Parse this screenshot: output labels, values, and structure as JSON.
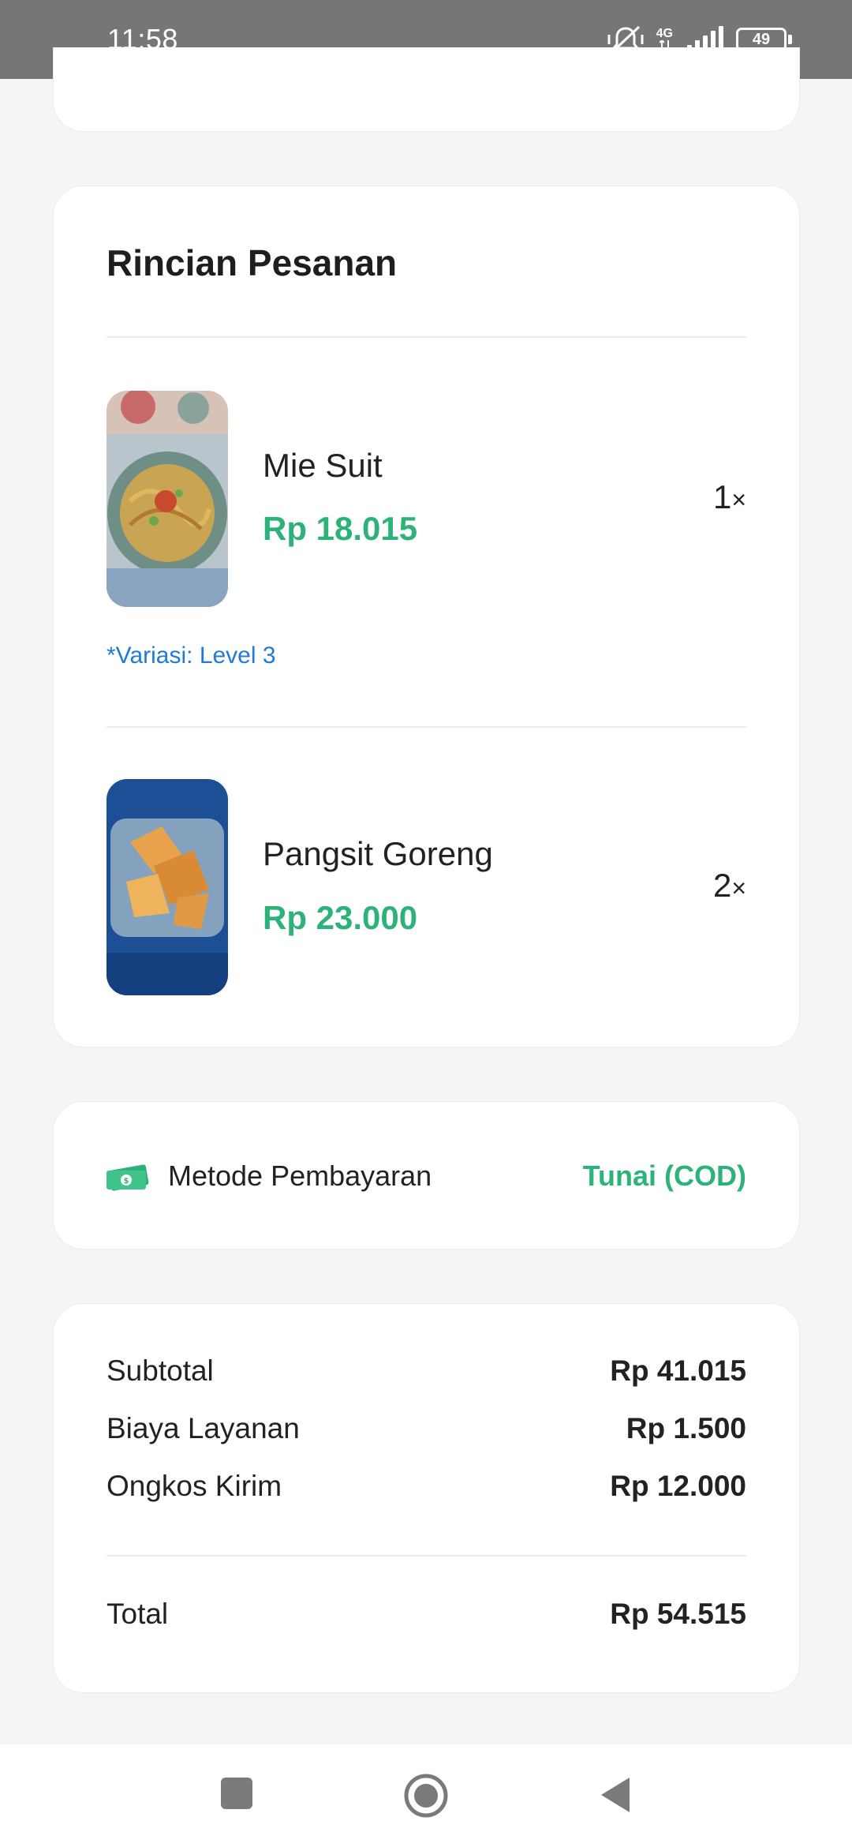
{
  "status_bar": {
    "time": "11:58",
    "network": "4G",
    "battery": "49"
  },
  "order": {
    "title": "Rincian Pesanan",
    "items": [
      {
        "name": "Mie Suit",
        "price": "Rp 18.015",
        "qty": "1",
        "qty_suffix": "×",
        "variation": "*Variasi: Level 3",
        "image": "noodles-photo"
      },
      {
        "name": "Pangsit Goreng",
        "price": "Rp 23.000",
        "qty": "2",
        "qty_suffix": "×",
        "image": "fried-wonton-photo"
      }
    ]
  },
  "payment": {
    "label": "Metode Pembayaran",
    "value": "Tunai (COD)",
    "icon": "cash-icon"
  },
  "summary": {
    "rows": [
      {
        "label": "Subtotal",
        "value": "Rp 41.015"
      },
      {
        "label": "Biaya Layanan",
        "value": "Rp 1.500"
      },
      {
        "label": "Ongkos Kirim",
        "value": "Rp 12.000"
      }
    ],
    "total_label": "Total",
    "total_value": "Rp 54.515"
  },
  "colors": {
    "accent_green": "#2db37a",
    "link_blue": "#1e7bd6",
    "status_bar": "#767676",
    "background": "#f5f5f5"
  },
  "nav": {
    "recents_icon": "square-icon",
    "home_icon": "circle-icon",
    "back_icon": "triangle-back-icon"
  }
}
